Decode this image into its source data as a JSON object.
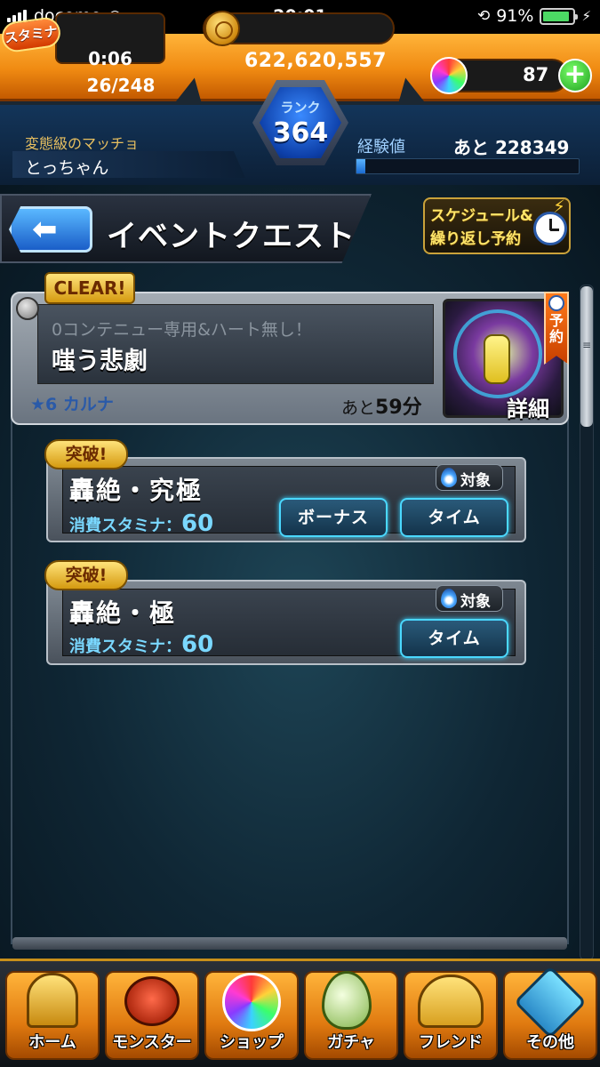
{
  "status_bar": {
    "carrier": "docomo",
    "time": "20:01",
    "battery": "91%"
  },
  "header": {
    "stamina_label": "スタミナ",
    "stamina_timer": "0:06",
    "stamina_value": "26/248",
    "gold": "622,620,557",
    "orbs": "87",
    "rank_label": "ランク",
    "rank": "364",
    "player_title": "変態級のマッチョ",
    "player_name": "とっちゃん",
    "exp_label": "経験値",
    "exp_remaining": "あと 228349",
    "exp_progress": 0.04
  },
  "page": {
    "title": "イベントクエスト",
    "back_icon": "back-arrow-icon",
    "schedule_line1": "スケジュール&",
    "schedule_line2": "繰り返し予約"
  },
  "event": {
    "clear_badge": "CLEAR!",
    "subtitle": "0コンテニュー専用&ハート無し！",
    "name": "嗤う悲劇",
    "stars": "★6 カルナ",
    "remaining_prefix": "あと",
    "remaining_value": "59分",
    "detail_label": "詳細",
    "reserve_label": "予約"
  },
  "quests": [
    {
      "badge": "突破!",
      "name": "轟絶・究極",
      "stamina_label": "消費スタミナ：",
      "stamina_value": "60",
      "target_label": "対象",
      "bonus_button": "ボーナス",
      "time_button": "タイム"
    },
    {
      "badge": "突破!",
      "name": "轟絶・極",
      "stamina_label": "消費スタミナ：",
      "stamina_value": "60",
      "target_label": "対象",
      "time_button": "タイム"
    }
  ],
  "nav": [
    {
      "label": "ホーム",
      "icon": "home-icon"
    },
    {
      "label": "モンスター",
      "icon": "monster-icon"
    },
    {
      "label": "ショップ",
      "icon": "orb-icon"
    },
    {
      "label": "ガチャ",
      "icon": "egg-icon"
    },
    {
      "label": "フレンド",
      "icon": "friends-icon"
    },
    {
      "label": "その他",
      "icon": "more-icon"
    }
  ],
  "colors": {
    "accent_orange": "#f08a12",
    "button_cyan": "#4ad8ff",
    "badge_gold": "#ffd23a"
  }
}
